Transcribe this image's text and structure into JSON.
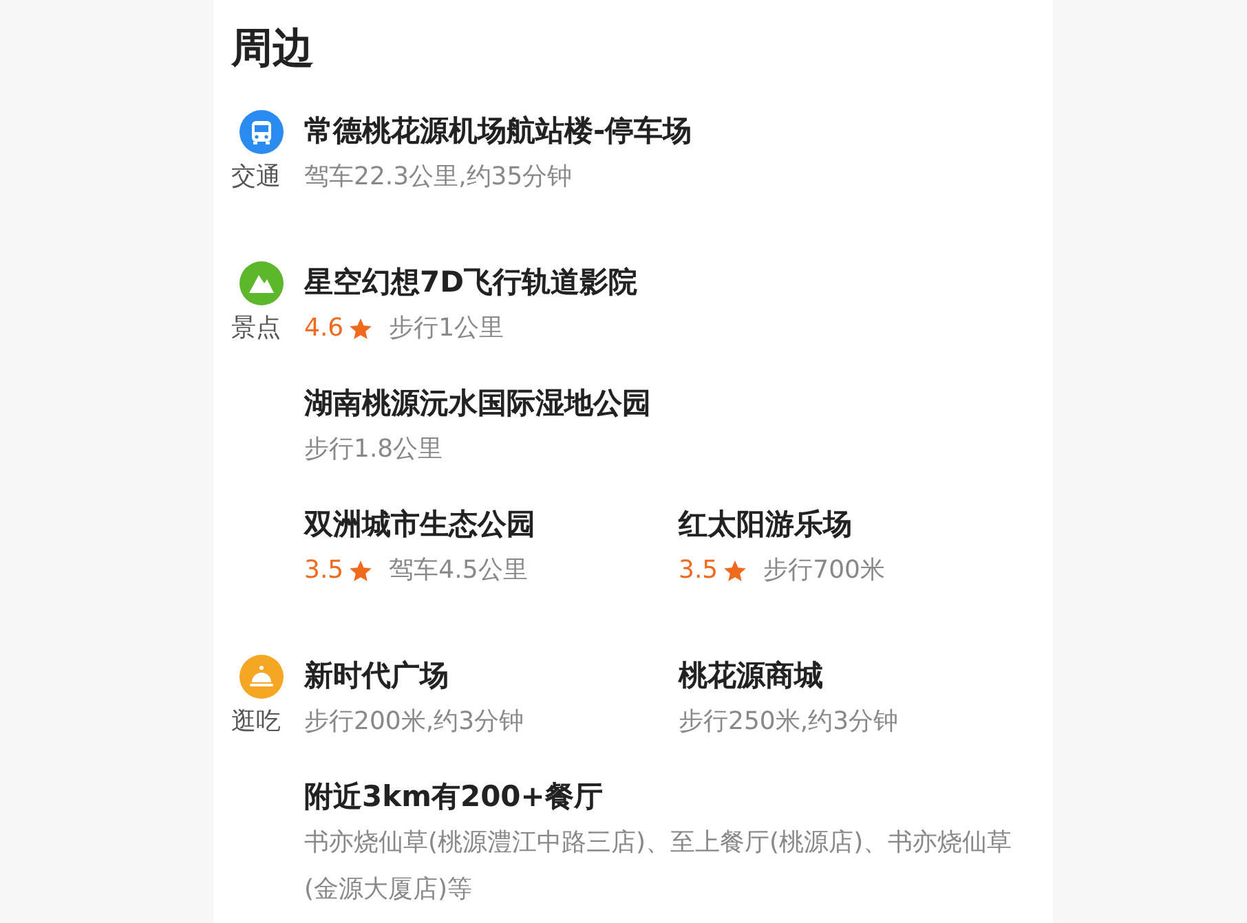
{
  "title": "周边",
  "sections": [
    {
      "kind": "transport",
      "category": "交通",
      "rows": [
        [
          {
            "kind": "place",
            "name": "常德桃花源机场航站楼-停车场",
            "detail": "驾车22.3公里,约35分钟"
          }
        ]
      ]
    },
    {
      "kind": "scenic",
      "category": "景点",
      "rows": [
        [
          {
            "kind": "place",
            "name": "星空幻想7D飞行轨道影院",
            "rating": "4.6",
            "detail": "步行1公里"
          }
        ],
        [
          {
            "kind": "place",
            "name": "湖南桃源沅水国际湿地公园",
            "detail": "步行1.8公里"
          }
        ],
        [
          {
            "kind": "place",
            "name": "双洲城市生态公园",
            "rating": "3.5",
            "detail": "驾车4.5公里"
          },
          {
            "kind": "place",
            "name": "红太阳游乐场",
            "rating": "3.5",
            "detail": "步行700米"
          }
        ]
      ]
    },
    {
      "kind": "food",
      "category": "逛吃",
      "rows": [
        [
          {
            "kind": "place",
            "name": "新时代广场",
            "detail": "步行200米,约3分钟"
          },
          {
            "kind": "place",
            "name": "桃花源商城",
            "detail": "步行250米,约3分钟"
          }
        ],
        [
          {
            "kind": "summary",
            "name": "附近3km有200+餐厅",
            "detail": "书亦烧仙草(桃源澧江中路三店)、至上餐厅(桃源店)、书亦烧仙草(金源大厦店)等"
          }
        ]
      ]
    }
  ]
}
